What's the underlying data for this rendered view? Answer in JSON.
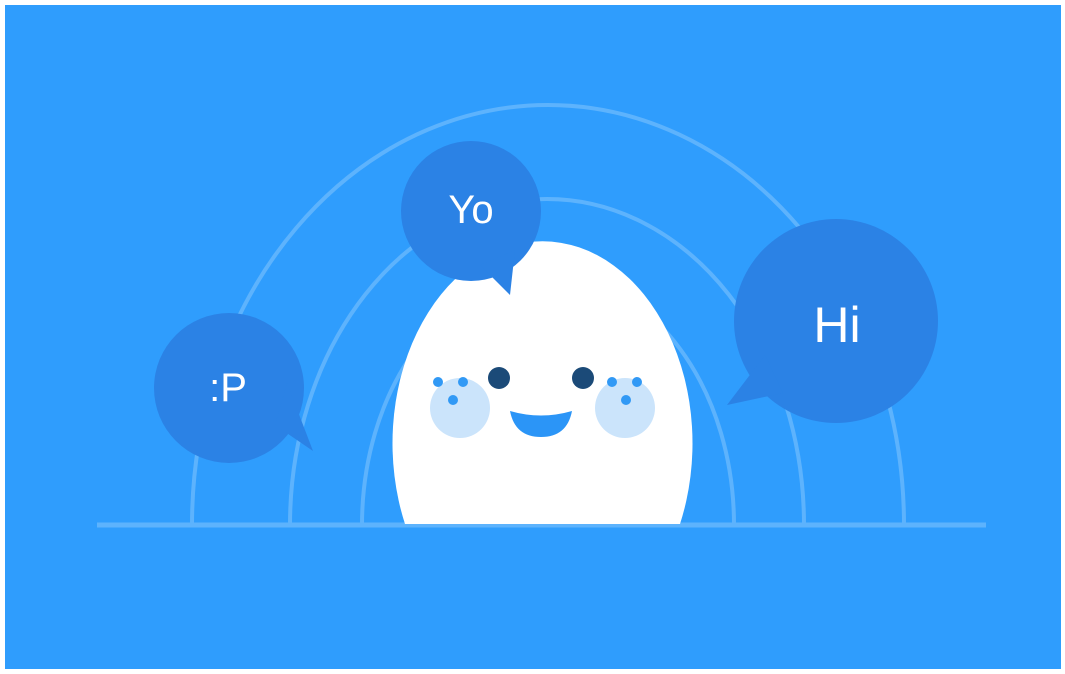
{
  "scene": {
    "background_color": "#2f9dfd",
    "ring_color": "#5db3fd",
    "bubble_color": "#2b82e5",
    "face_color": "#ffffff",
    "cheek_color": "#cbe4fb",
    "freckle_color": "#3199f5",
    "eye_color": "#1b4a78",
    "mouth_color": "#2b95f7"
  },
  "bubbles": {
    "left": {
      "text": ":P",
      "icon": "speech-bubble-icon"
    },
    "top": {
      "text": "Yo",
      "icon": "speech-bubble-icon"
    },
    "right": {
      "text": "Hi",
      "icon": "speech-bubble-icon"
    }
  },
  "character": {
    "icon": "smiling-face-icon"
  }
}
